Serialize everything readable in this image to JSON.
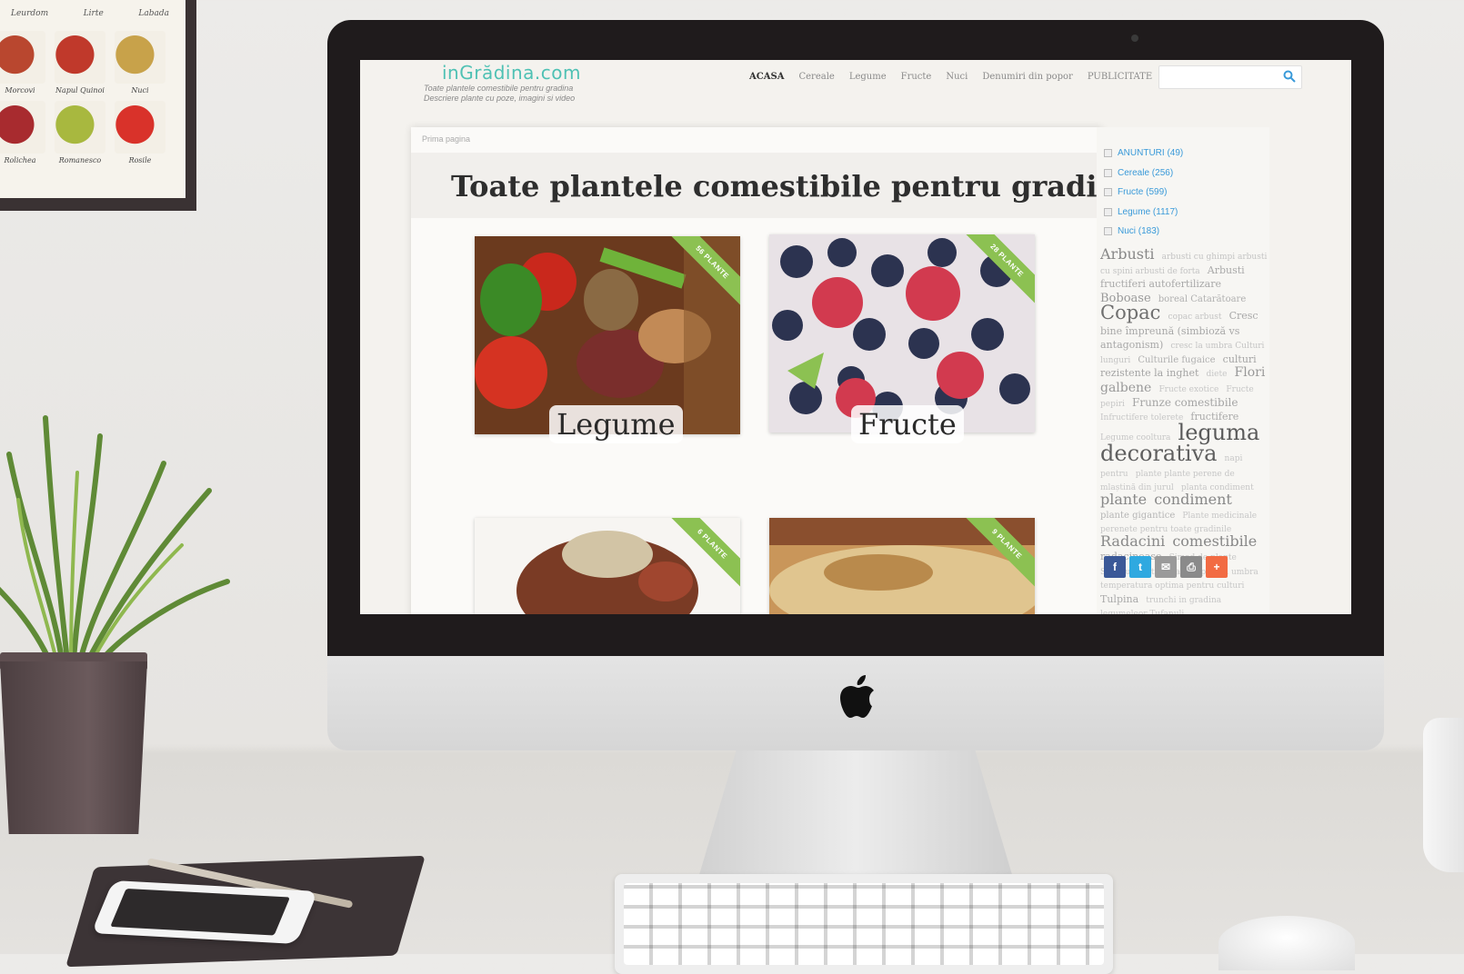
{
  "frame": {
    "top_labels": [
      "Leurdom",
      "Lirte",
      "Labada"
    ],
    "items": [
      {
        "caption": "Morcovi",
        "color": "#b9472f"
      },
      {
        "caption": "Napul Quinoi",
        "color": "#c0392b"
      },
      {
        "caption": "Nuci",
        "color": "#c8a24a"
      },
      {
        "caption": "Rolichea",
        "color": "#a82b2f"
      },
      {
        "caption": "Romanesco",
        "color": "#a8b83f"
      },
      {
        "caption": "Rosile",
        "color": "#d9322a"
      }
    ]
  },
  "site": {
    "logo": "inGrădina.com",
    "tagline_line1": "Toate plantele comestibile pentru gradina",
    "tagline_line2": "Descriere plante cu poze, imagini si video",
    "nav": [
      "ACASA",
      "Cereale",
      "Legume",
      "Fructe",
      "Nuci",
      "Denumiri din popor",
      "PUBLICITATE"
    ],
    "search": {
      "placeholder": ""
    },
    "breadcrumb": "Prima pagina",
    "page_title": "Toate plantele comestibile pentru gradina",
    "categories": [
      {
        "label": "Legume",
        "ribbon": "56 PLANTE",
        "color1": "#8c3b24",
        "color2": "#4a7f2b"
      },
      {
        "label": "Fructe",
        "ribbon": "28 PLANTE",
        "color1": "#2c3548",
        "color2": "#c43a4d"
      },
      {
        "label": "",
        "ribbon": "6 PLANTE",
        "color1": "#7a3b25",
        "color2": "#d2c4a5"
      },
      {
        "label": "",
        "ribbon": "9 PLANTE",
        "color1": "#b98a4c",
        "color2": "#e0c58f"
      }
    ],
    "sidebar": {
      "list": [
        "ANUNTURI (49)",
        "Cereale (256)",
        "Fructe (599)",
        "Legume (1117)",
        "Nuci (183)"
      ],
      "tags": [
        {
          "t": "Arbusti",
          "s": 16,
          "c": "#888"
        },
        {
          "t": "arbusti cu ghimpi arbusti cu spini arbusti de forta",
          "s": 9,
          "c": "#c3c3c3"
        },
        {
          "t": "Arbusti fructiferi autofertilizare",
          "s": 11,
          "c": "#a9a9a9"
        },
        {
          "t": "Boboase",
          "s": 13,
          "c": "#999"
        },
        {
          "t": "boreal Catarătoare",
          "s": 10,
          "c": "#b0b0b0"
        },
        {
          "t": "Copac",
          "s": 21,
          "c": "#6f6f6f"
        },
        {
          "t": "copac arbust",
          "s": 9,
          "c": "#c3c3c3"
        },
        {
          "t": "Cresc bine împreună (simbioză vs antagonism)",
          "s": 11,
          "c": "#a8a8a8"
        },
        {
          "t": "cresc la umbra Culturi lunguri",
          "s": 9,
          "c": "#c3c3c3"
        },
        {
          "t": "Culturile fugaice",
          "s": 10,
          "c": "#b0b0b0"
        },
        {
          "t": "culturi rezistente la inghet",
          "s": 11,
          "c": "#a5a5a5"
        },
        {
          "t": "diete",
          "s": 9,
          "c": "#c6c6c6"
        },
        {
          "t": "Flori galbene",
          "s": 14,
          "c": "#999"
        },
        {
          "t": "Fructe exotice",
          "s": 9,
          "c": "#c6c6c6"
        },
        {
          "t": "Fructe pepiri",
          "s": 9,
          "c": "#c6c6c6"
        },
        {
          "t": "Frunze comestibile",
          "s": 12,
          "c": "#a5a5a5"
        },
        {
          "t": "Infructifere tolerete",
          "s": 9,
          "c": "#c6c6c6"
        },
        {
          "t": "fructifere",
          "s": 11,
          "c": "#aaa"
        },
        {
          "t": "Legume cooltura",
          "s": 9,
          "c": "#c6c6c6"
        },
        {
          "t": "leguma",
          "s": 24,
          "c": "#5a5a5a"
        },
        {
          "t": "decorativa",
          "s": 24,
          "c": "#5f5f5f"
        },
        {
          "t": "napi pentru",
          "s": 9,
          "c": "#c6c6c6"
        },
        {
          "t": "plante plante perene de mlaștină din jurul",
          "s": 9,
          "c": "#c6c6c6"
        },
        {
          "t": "planta condiment",
          "s": 9,
          "c": "#c6c6c6"
        },
        {
          "t": "plante",
          "s": 16,
          "c": "#888"
        },
        {
          "t": "condiment",
          "s": 16,
          "c": "#888"
        },
        {
          "t": "plante gigantice",
          "s": 10,
          "c": "#b5b5b5"
        },
        {
          "t": "Plante medicinale perenete pentru toate gradinile",
          "s": 9,
          "c": "#c6c6c6"
        },
        {
          "t": "Radacini",
          "s": 16,
          "c": "#8a8a8a"
        },
        {
          "t": "comestibile",
          "s": 16,
          "c": "#888"
        },
        {
          "t": "radacinoase",
          "s": 11,
          "c": "#aaa"
        },
        {
          "t": "Simad de plante Sezonul pentru gradina pentru umbra temperatura optima pentru culturi",
          "s": 9,
          "c": "#c6c6c6"
        },
        {
          "t": "Tulpina",
          "s": 11,
          "c": "#aaa"
        },
        {
          "t": "trunchi in gradina legumeleor Tufanuli",
          "s": 9,
          "c": "#c6c6c6"
        }
      ]
    },
    "share": [
      {
        "icon": "facebook-icon",
        "glyph": "f",
        "color": "#3b5998"
      },
      {
        "icon": "twitter-icon",
        "glyph": "t",
        "color": "#2fa9e0"
      },
      {
        "icon": "email-icon",
        "glyph": "✉",
        "color": "#9a9a9a"
      },
      {
        "icon": "print-icon",
        "glyph": "⎙",
        "color": "#8a8a8a"
      },
      {
        "icon": "more-icon",
        "glyph": "+",
        "color": "#f26b43"
      }
    ]
  }
}
